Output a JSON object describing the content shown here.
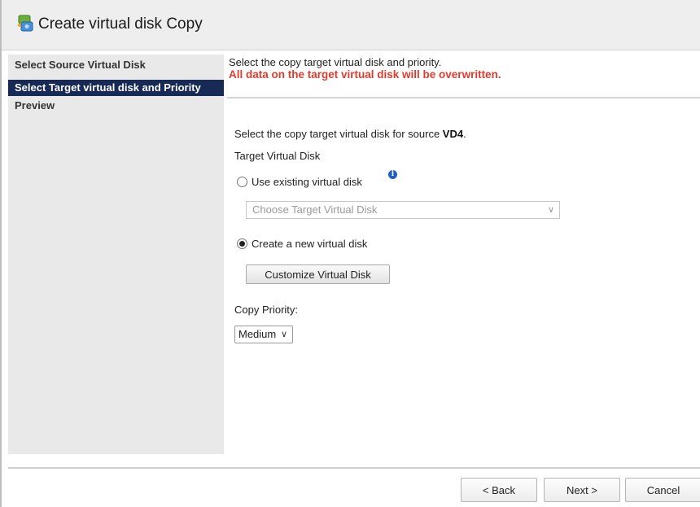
{
  "window": {
    "title": "Create virtual disk Copy",
    "icon": "virtual-disk-copy-icon"
  },
  "sidebar": {
    "items": [
      {
        "label": "Select Source Virtual Disk",
        "active": false
      },
      {
        "label": "Select Target virtual disk and Priority",
        "active": true
      },
      {
        "label": "Preview",
        "active": false
      }
    ],
    "active_color": "#162a55"
  },
  "content": {
    "instruction": "Select the copy target virtual disk and priority.",
    "warning": "All data on the target virtual disk will be overwritten.",
    "warning_color": "#e23b2e",
    "source_prefix": "Select the copy target virtual disk for source ",
    "source_name": "VD4",
    "source_suffix": ".",
    "target_label": "Target Virtual Disk",
    "option_existing": {
      "label": "Use existing virtual disk",
      "selected": false,
      "info_icon": "info-icon"
    },
    "target_select": {
      "placeholder": "Choose Target Virtual Disk",
      "disabled": true
    },
    "option_new": {
      "label": "Create a new virtual disk",
      "selected": true
    },
    "customize_button": "Customize Virtual Disk",
    "priority_label": "Copy Priority:",
    "priority_value": "Medium"
  },
  "footer": {
    "back": "< Back",
    "next": "Next >",
    "cancel": "Cancel"
  }
}
